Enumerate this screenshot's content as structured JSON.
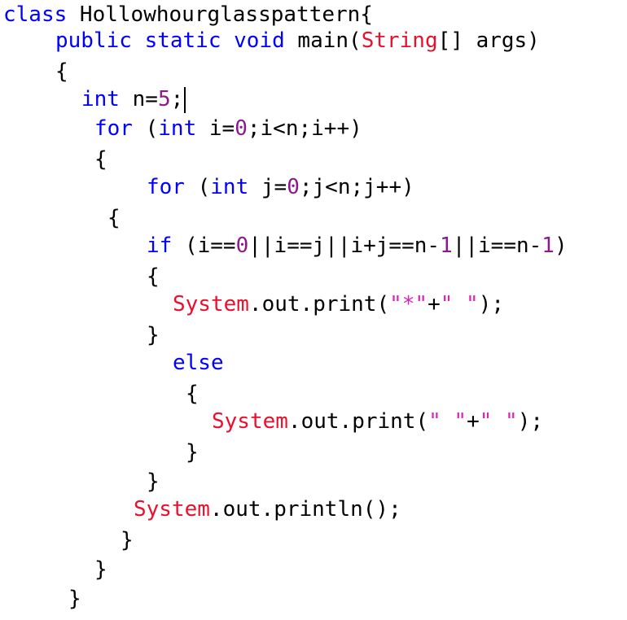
{
  "code": {
    "lines": [
      [
        {
          "t": "kw",
          "v": "class"
        },
        {
          "t": "plain",
          "v": " Hollowhourglasspattern{"
        }
      ],
      [
        {
          "t": "kw",
          "v": "public static void"
        },
        {
          "t": "plain",
          "v": " main("
        },
        {
          "t": "cls",
          "v": "String"
        },
        {
          "t": "plain",
          "v": "[] args)"
        }
      ],
      [
        {
          "t": "plain",
          "v": "{"
        }
      ],
      [
        {
          "t": "kw",
          "v": "int"
        },
        {
          "t": "plain",
          "v": " n="
        },
        {
          "t": "num",
          "v": "5"
        },
        {
          "t": "plain",
          "v": ";"
        }
      ],
      [
        {
          "t": "kw",
          "v": "for"
        },
        {
          "t": "plain",
          "v": " ("
        },
        {
          "t": "kw",
          "v": "int"
        },
        {
          "t": "plain",
          "v": " i="
        },
        {
          "t": "num",
          "v": "0"
        },
        {
          "t": "plain",
          "v": ";i<n;i++)"
        }
      ],
      [
        {
          "t": "plain",
          "v": "{"
        }
      ],
      [
        {
          "t": "kw",
          "v": "for"
        },
        {
          "t": "plain",
          "v": " ("
        },
        {
          "t": "kw",
          "v": "int"
        },
        {
          "t": "plain",
          "v": " j="
        },
        {
          "t": "num",
          "v": "0"
        },
        {
          "t": "plain",
          "v": ";j<n;j++)"
        }
      ],
      [
        {
          "t": "plain",
          "v": "{"
        }
      ],
      [
        {
          "t": "kw",
          "v": "if"
        },
        {
          "t": "plain",
          "v": " (i=="
        },
        {
          "t": "num",
          "v": "0"
        },
        {
          "t": "plain",
          "v": "||i==j||i+j==n-"
        },
        {
          "t": "num",
          "v": "1"
        },
        {
          "t": "plain",
          "v": "||i==n-"
        },
        {
          "t": "num",
          "v": "1"
        },
        {
          "t": "plain",
          "v": ")"
        }
      ],
      [
        {
          "t": "plain",
          "v": "{"
        }
      ],
      [
        {
          "t": "cls",
          "v": "System"
        },
        {
          "t": "plain",
          "v": ".out.print("
        },
        {
          "t": "str",
          "v": "\"*\""
        },
        {
          "t": "plain",
          "v": "+"
        },
        {
          "t": "str",
          "v": "\" \""
        },
        {
          "t": "plain",
          "v": ");"
        }
      ],
      [
        {
          "t": "plain",
          "v": "}"
        }
      ],
      [
        {
          "t": "kw",
          "v": "else"
        }
      ],
      [
        {
          "t": "plain",
          "v": "{"
        }
      ],
      [
        {
          "t": "cls",
          "v": "System"
        },
        {
          "t": "plain",
          "v": ".out.print("
        },
        {
          "t": "str",
          "v": "\" \""
        },
        {
          "t": "plain",
          "v": "+"
        },
        {
          "t": "str",
          "v": "\" \""
        },
        {
          "t": "plain",
          "v": ");"
        }
      ],
      [
        {
          "t": "plain",
          "v": "}"
        }
      ],
      [
        {
          "t": "plain",
          "v": "}"
        }
      ],
      [
        {
          "t": "cls",
          "v": "System"
        },
        {
          "t": "plain",
          "v": ".out.println();"
        }
      ],
      [
        {
          "t": "plain",
          "v": "}"
        }
      ],
      [
        {
          "t": "plain",
          "v": "}"
        }
      ],
      [
        {
          "t": "plain",
          "v": "}"
        }
      ]
    ],
    "cursor_line": 3
  },
  "colors": {
    "keyword": "#0000ff",
    "class_name": "#e8102c",
    "number": "#8b1a8b",
    "string": "#e020b8",
    "text": "#000000",
    "background": "#ffffff"
  }
}
